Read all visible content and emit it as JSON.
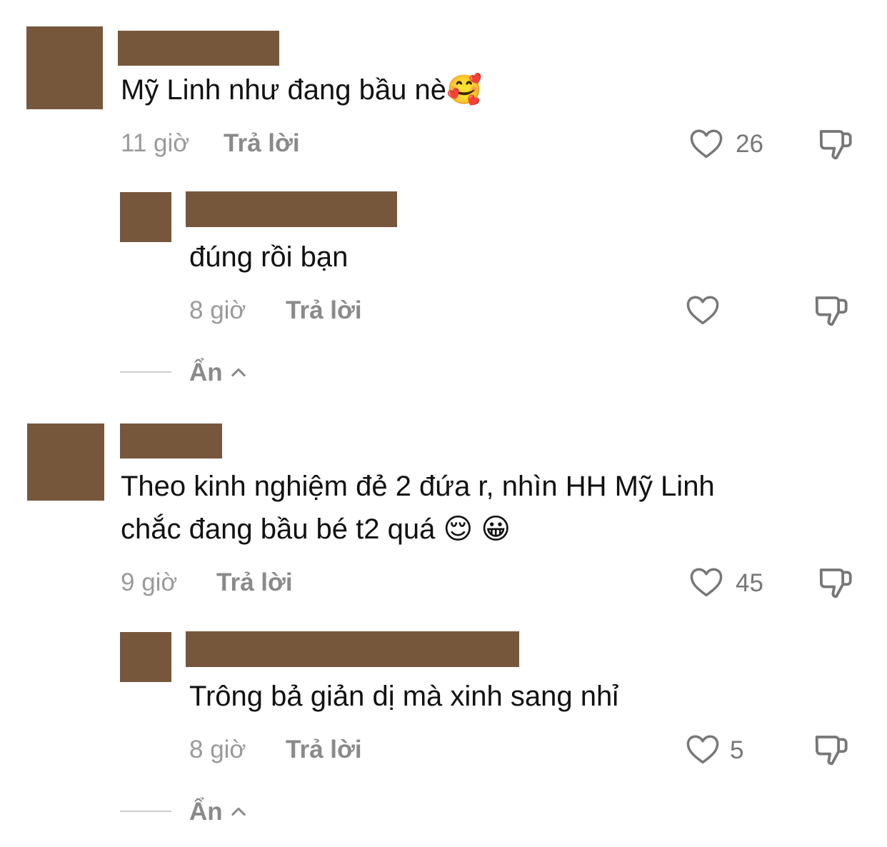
{
  "colors": {
    "redaction": "#77573c",
    "text": "#111111",
    "meta": "#9a9a9a",
    "reply": "#8a8a8a",
    "icon": "#777777"
  },
  "comments": [
    {
      "text": "Mỹ Linh như đang bầu nè",
      "emoji": "🥰",
      "time": "11 giờ",
      "reply_label": "Trả lời",
      "likes": "26",
      "replies": [
        {
          "text": "đúng rồi bạn",
          "time": "8 giờ",
          "reply_label": "Trả lời",
          "likes": ""
        }
      ],
      "hide_label": "Ẩn"
    },
    {
      "text_line1": "Theo kinh nghiệm đẻ 2 đứa r, nhìn HH Mỹ Linh",
      "text_line2": "chắc đang bầu bé t2 quá ",
      "emoji1": "😌",
      "emoji2": "😀",
      "time": "9 giờ",
      "reply_label": "Trả lời",
      "likes": "45",
      "replies": [
        {
          "text": "Trông bả giản dị mà xinh sang nhỉ",
          "time": "8 giờ",
          "reply_label": "Trả lời",
          "likes": "5"
        }
      ],
      "hide_label": "Ẩn"
    }
  ],
  "icons": {
    "like": "heart-outline-icon",
    "dislike": "thumbs-down-icon",
    "collapse": "chevron-up-icon"
  }
}
